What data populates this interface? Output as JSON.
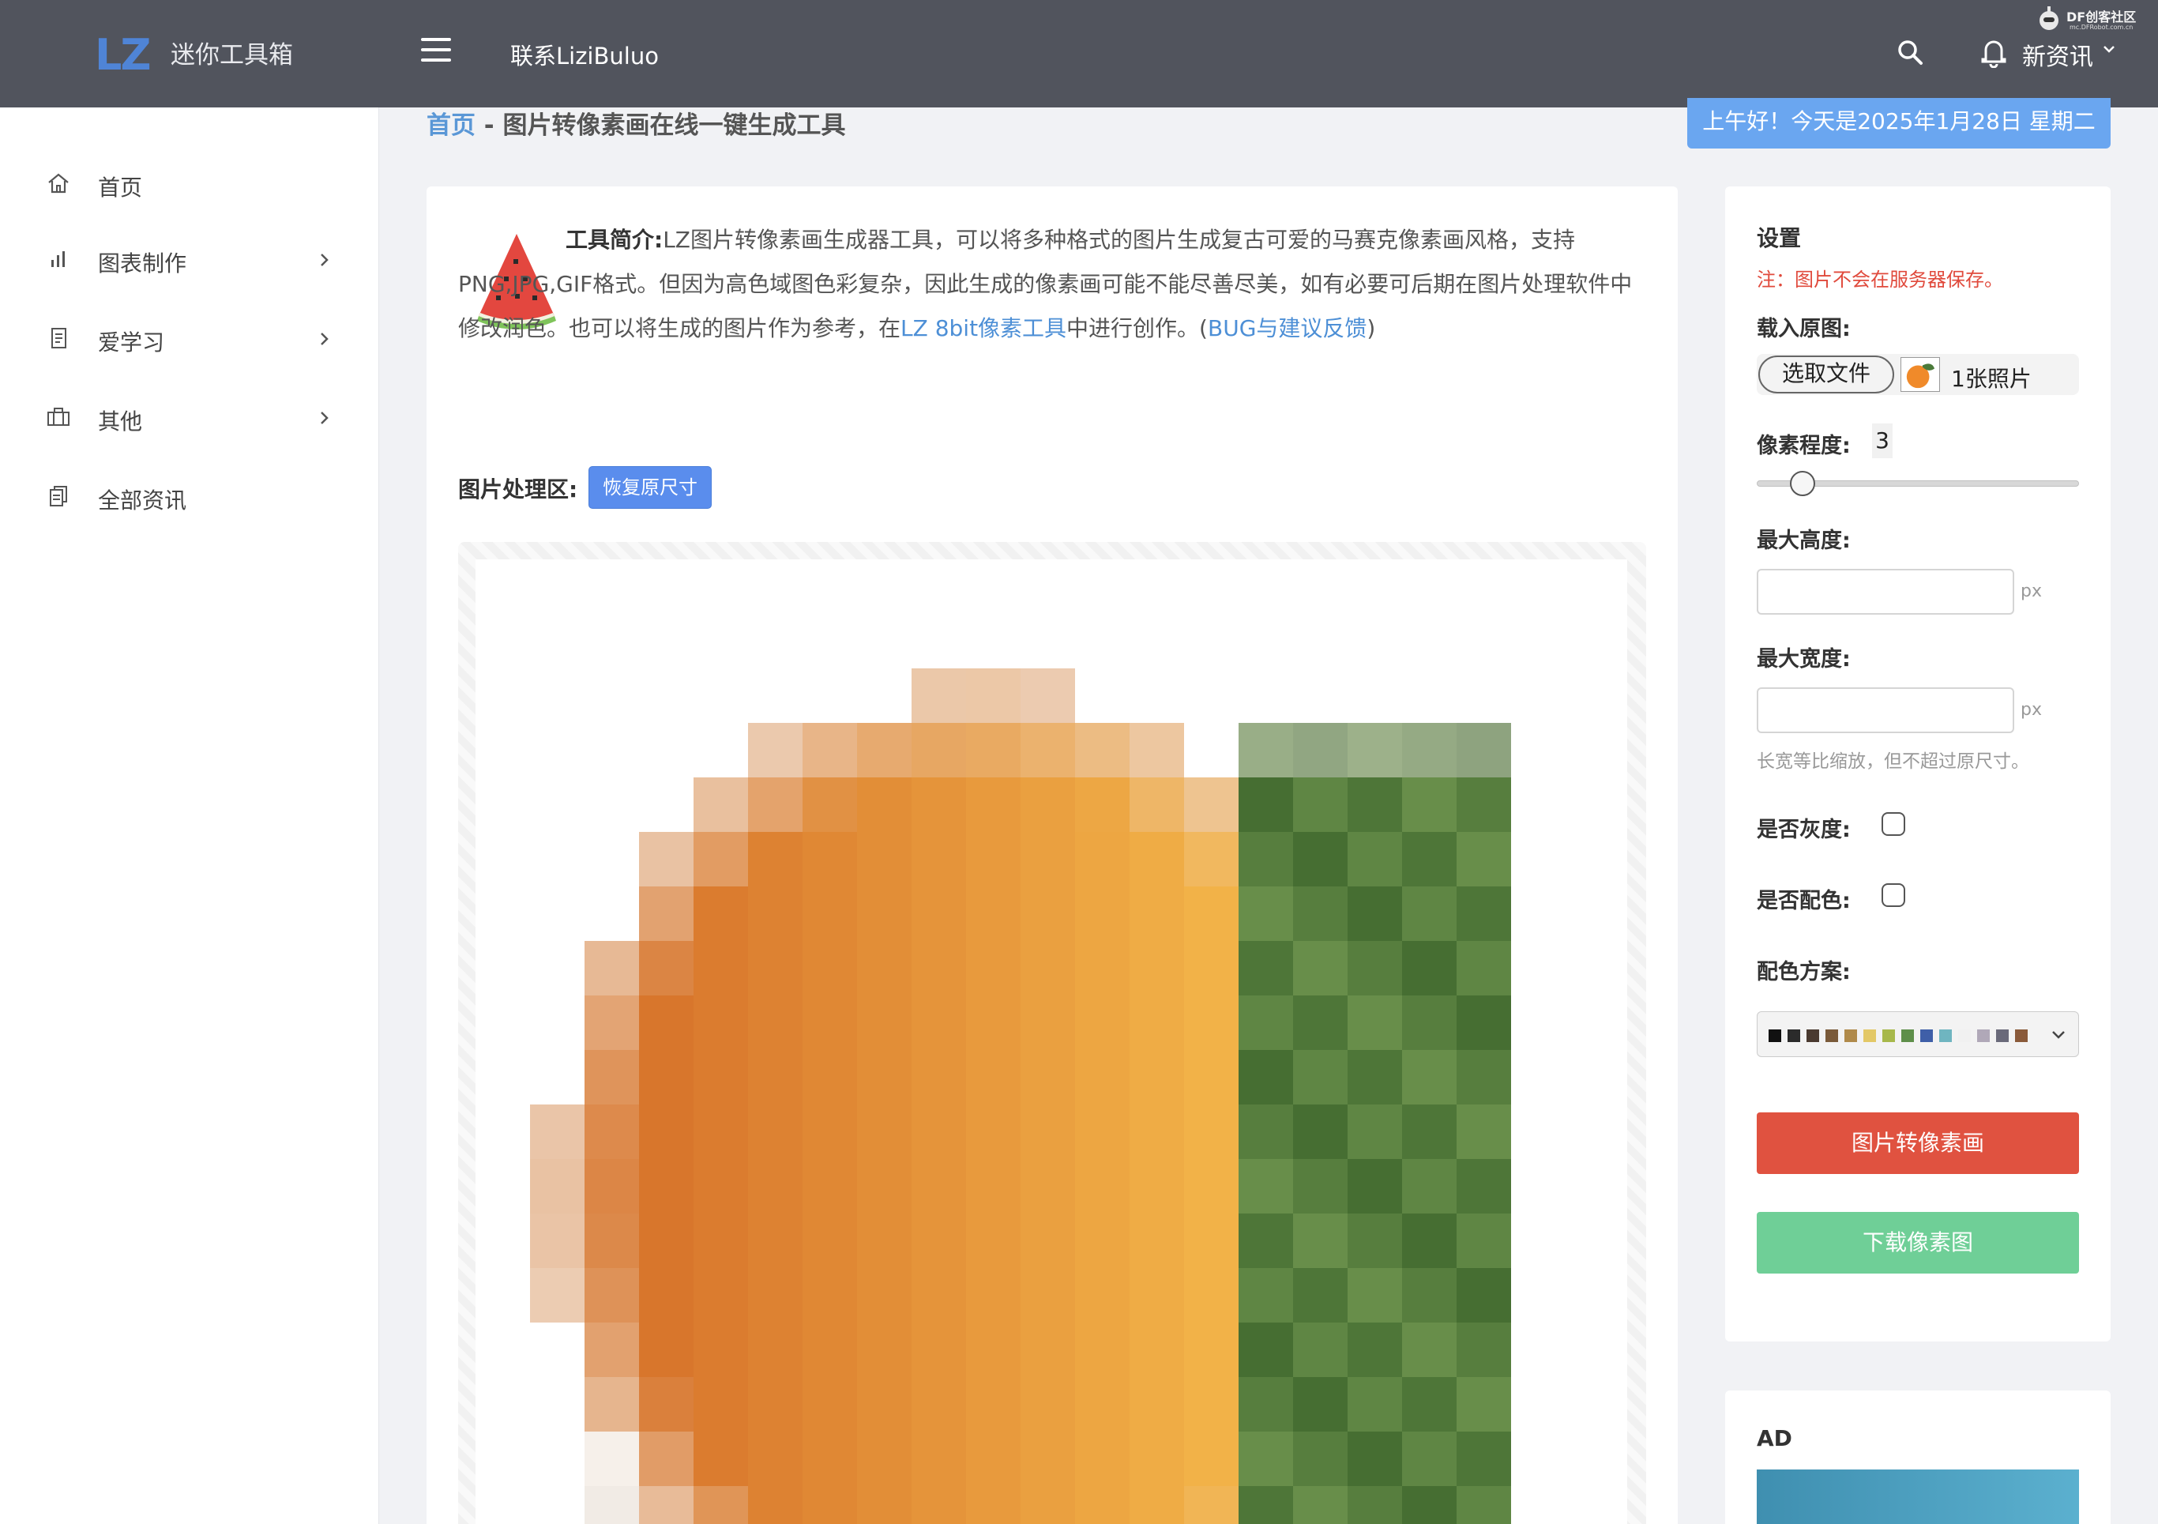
{
  "header": {
    "logo_mark": "LZ",
    "logo_text": "迷你工具箱",
    "contact": "联系LiziBuluo",
    "news": "新资讯",
    "watermark_title": "DF创客社区",
    "watermark_url": "mc.DFRobot.com.cn"
  },
  "sidebar": {
    "items": [
      {
        "label": "首页",
        "icon": "home-icon",
        "has_chevron": false
      },
      {
        "label": "图表制作",
        "icon": "bar-chart-icon",
        "has_chevron": true
      },
      {
        "label": "爱学习",
        "icon": "book-icon",
        "has_chevron": true
      },
      {
        "label": "其他",
        "icon": "briefcase-icon",
        "has_chevron": true
      },
      {
        "label": "全部资讯",
        "icon": "documents-icon",
        "has_chevron": false
      }
    ]
  },
  "breadcrumb": {
    "home": "首页",
    "separator": " - ",
    "current": "图片转像素画在线一键生成工具"
  },
  "greeting": "上午好！今天是2025年1月28日  星期二",
  "intro": {
    "bold": "工具简介:",
    "text1": "LZ图片转像素画生成器工具，可以将多种格式的图片生成复古可爱的马赛克像素画风格，支持PNG,JPG,GIF格式。但因为高色域图色彩复杂，因此生成的像素画可能不能尽善尽美，如有必要可后期在图片处理软件中修改润色。也可以将生成的图片作为参考，在",
    "link1": "LZ 8bit像素工具",
    "text2": "中进行创作。(",
    "link2": "BUG与建议反馈",
    "text3": ")"
  },
  "processing": {
    "label": "图片处理区:",
    "restore_button": "恢复原尺寸"
  },
  "settings": {
    "title": "设置",
    "note": "注：图片不会在服务器保存。",
    "load_label": "载入原图:",
    "file_button": "选取文件",
    "file_count": "1张照片",
    "pixel_label": "像素程度:",
    "pixel_value": "3",
    "pixel_level_fraction": 0.1,
    "max_height_label": "最大高度:",
    "max_height_value": "",
    "max_width_label": "最大宽度:",
    "max_width_value": "",
    "unit": "px",
    "hint": "长宽等比缩放，但不超过原尺寸。",
    "gray_label": "是否灰度:",
    "gray_checked": false,
    "palette_enable_label": "是否配色:",
    "palette_enable_checked": false,
    "palette_label": "配色方案:",
    "palette_colors": [
      "#111111",
      "#2b2b2b",
      "#4a3a30",
      "#7a5a3a",
      "#b08a4a",
      "#e3c866",
      "#a7b84a",
      "#5e8f4a",
      "#3f5fa8",
      "#6fb5c0",
      "#f1f1f1",
      "#b0a8b8",
      "#6a6a7a",
      "#8a5a3a"
    ],
    "convert_button": "图片转像素画",
    "download_button": "下载像素图"
  },
  "ad": {
    "title": "AD"
  },
  "colors": {
    "topbar": "#51545d",
    "accent_blue": "#5a8ded",
    "link_blue": "#4d8fd6",
    "convert_red": "#e05240",
    "download_green": "#6fcf97",
    "note_red": "#e04a3c"
  }
}
